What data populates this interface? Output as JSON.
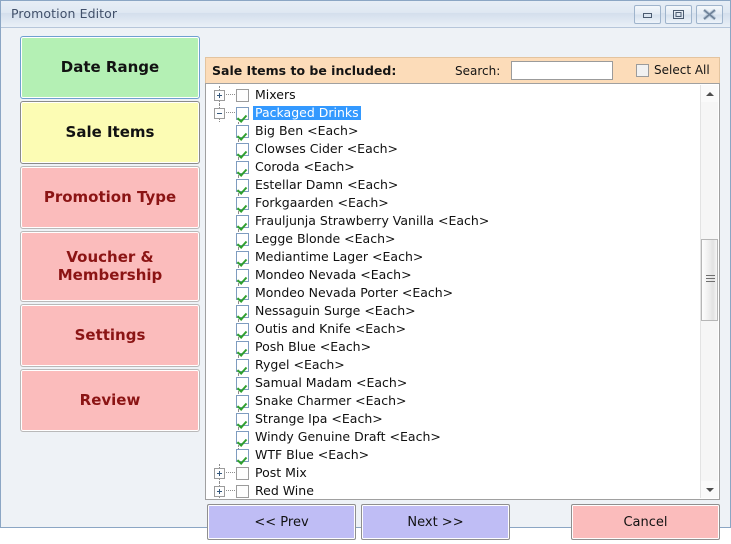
{
  "window": {
    "title": "Promotion Editor",
    "controls": [
      {
        "name": "minimize",
        "label": "Minimize"
      },
      {
        "name": "maximize",
        "label": "Maximize"
      },
      {
        "name": "close",
        "label": "Close"
      }
    ]
  },
  "sidebar": {
    "items": [
      {
        "label": "Date Range",
        "state": "completed",
        "color": "#b4f0b4"
      },
      {
        "label": "Sale Items",
        "state": "active",
        "color": "#fcfcb4"
      },
      {
        "label": "Promotion Type",
        "state": "pending",
        "color": "#fbbcbc"
      },
      {
        "label": "Voucher & Membership",
        "state": "pending",
        "color": "#fbbcbc"
      },
      {
        "label": "Settings",
        "state": "pending",
        "color": "#fbbcbc"
      },
      {
        "label": "Review",
        "state": "pending",
        "color": "#fbbcbc"
      }
    ]
  },
  "panel": {
    "title": "Sale Items to be included:",
    "search_label": "Search:",
    "search_value": "",
    "search_placeholder": "",
    "select_all_label": "Select All",
    "select_all_checked": false,
    "header_bg": "#fcdcb9"
  },
  "tree": {
    "selection_color": "#3399ff",
    "nodes": [
      {
        "label": "Mixers",
        "level": 0,
        "expander": "plus",
        "checked": false,
        "selected": false
      },
      {
        "label": "Packaged Drinks",
        "level": 0,
        "expander": "minus",
        "checked": true,
        "selected": true
      },
      {
        "label": "Big Ben <Each>",
        "level": 1,
        "expander": "none",
        "checked": true,
        "selected": false
      },
      {
        "label": "Clowses Cider <Each>",
        "level": 1,
        "expander": "none",
        "checked": true,
        "selected": false
      },
      {
        "label": "Coroda <Each>",
        "level": 1,
        "expander": "none",
        "checked": true,
        "selected": false
      },
      {
        "label": "Estellar Damn <Each>",
        "level": 1,
        "expander": "none",
        "checked": true,
        "selected": false
      },
      {
        "label": "Forkgaarden <Each>",
        "level": 1,
        "expander": "none",
        "checked": true,
        "selected": false
      },
      {
        "label": "Frauljunja Strawberry Vanilla <Each>",
        "level": 1,
        "expander": "none",
        "checked": true,
        "selected": false
      },
      {
        "label": "Legge Blonde <Each>",
        "level": 1,
        "expander": "none",
        "checked": true,
        "selected": false
      },
      {
        "label": "Mediantime Lager <Each>",
        "level": 1,
        "expander": "none",
        "checked": true,
        "selected": false
      },
      {
        "label": "Mondeo Nevada <Each>",
        "level": 1,
        "expander": "none",
        "checked": true,
        "selected": false
      },
      {
        "label": "Mondeo Nevada Porter <Each>",
        "level": 1,
        "expander": "none",
        "checked": true,
        "selected": false
      },
      {
        "label": "Nessaguin Surge <Each>",
        "level": 1,
        "expander": "none",
        "checked": true,
        "selected": false
      },
      {
        "label": "Outis and Knife <Each>",
        "level": 1,
        "expander": "none",
        "checked": true,
        "selected": false
      },
      {
        "label": "Posh Blue <Each>",
        "level": 1,
        "expander": "none",
        "checked": true,
        "selected": false
      },
      {
        "label": "Rygel <Each>",
        "level": 1,
        "expander": "none",
        "checked": true,
        "selected": false
      },
      {
        "label": "Samual Madam <Each>",
        "level": 1,
        "expander": "none",
        "checked": true,
        "selected": false
      },
      {
        "label": "Snake Charmer <Each>",
        "level": 1,
        "expander": "none",
        "checked": true,
        "selected": false
      },
      {
        "label": "Strange Ipa <Each>",
        "level": 1,
        "expander": "none",
        "checked": true,
        "selected": false
      },
      {
        "label": "Windy Genuine Draft <Each>",
        "level": 1,
        "expander": "none",
        "checked": true,
        "selected": false
      },
      {
        "label": "WTF Blue <Each>",
        "level": 1,
        "expander": "none",
        "checked": true,
        "selected": false
      },
      {
        "label": "Post Mix",
        "level": 0,
        "expander": "plus",
        "checked": false,
        "selected": false
      },
      {
        "label": "Red Wine",
        "level": 0,
        "expander": "plus",
        "checked": false,
        "selected": false
      }
    ]
  },
  "footer": {
    "prev_label": "<< Prev",
    "next_label": "Next >>",
    "cancel_label": "Cancel"
  }
}
